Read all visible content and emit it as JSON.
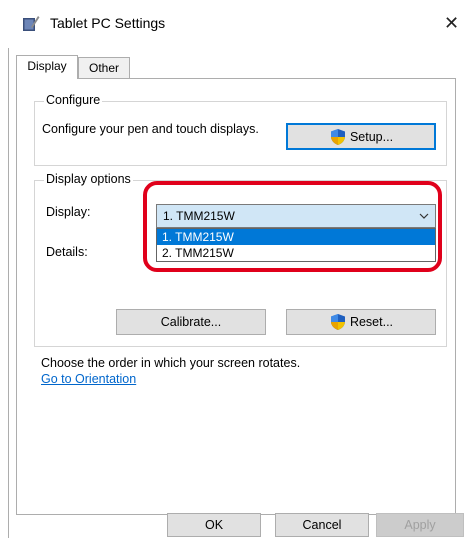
{
  "window": {
    "title": "Tablet PC Settings",
    "close_glyph": "✕"
  },
  "tabs": [
    {
      "label": "Display",
      "active": true
    },
    {
      "label": "Other",
      "active": false
    }
  ],
  "configure": {
    "group_label": "Configure",
    "description": "Configure your pen and touch displays.",
    "setup_label": "Setup..."
  },
  "display_options": {
    "group_label": "Display options",
    "display_label": "Display:",
    "details_label": "Details:",
    "selected_value": "1. TMM215W",
    "options": [
      "1. TMM215W",
      "2. TMM215W"
    ],
    "calibrate_label": "Calibrate...",
    "reset_label": "Reset..."
  },
  "orientation": {
    "text": "Choose the order in which your screen rotates.",
    "link": "Go to Orientation"
  },
  "footer": {
    "ok_label": "OK",
    "cancel_label": "Cancel",
    "apply_label": "Apply"
  },
  "colors": {
    "accent": "#0078d7",
    "highlight": "#e0001b",
    "link": "#0066cc"
  },
  "icons": [
    "tablet-pen-icon",
    "uac-shield-icon",
    "chevron-down-icon",
    "close-icon"
  ]
}
